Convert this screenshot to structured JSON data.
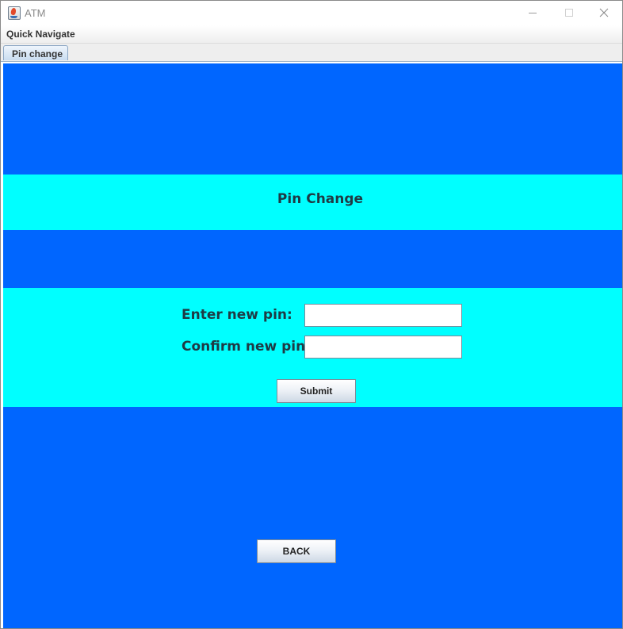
{
  "window": {
    "title": "ATM",
    "icon": "java-cup-icon"
  },
  "menubar": {
    "items": [
      {
        "label": "Quick Navigate"
      }
    ]
  },
  "tabs": [
    {
      "label": "Pin change",
      "selected": true
    }
  ],
  "pin_change": {
    "heading": "Pin Change",
    "new_pin_label": "Enter new pin:",
    "new_pin_value": "",
    "confirm_pin_label": "Confirm new pin:",
    "confirm_pin_value": "",
    "submit_label": "Submit"
  },
  "back_label": "BACK",
  "colors": {
    "panel_blue": "#0066ff",
    "band_cyan": "#00ffff",
    "label_text": "#1f3a44"
  }
}
